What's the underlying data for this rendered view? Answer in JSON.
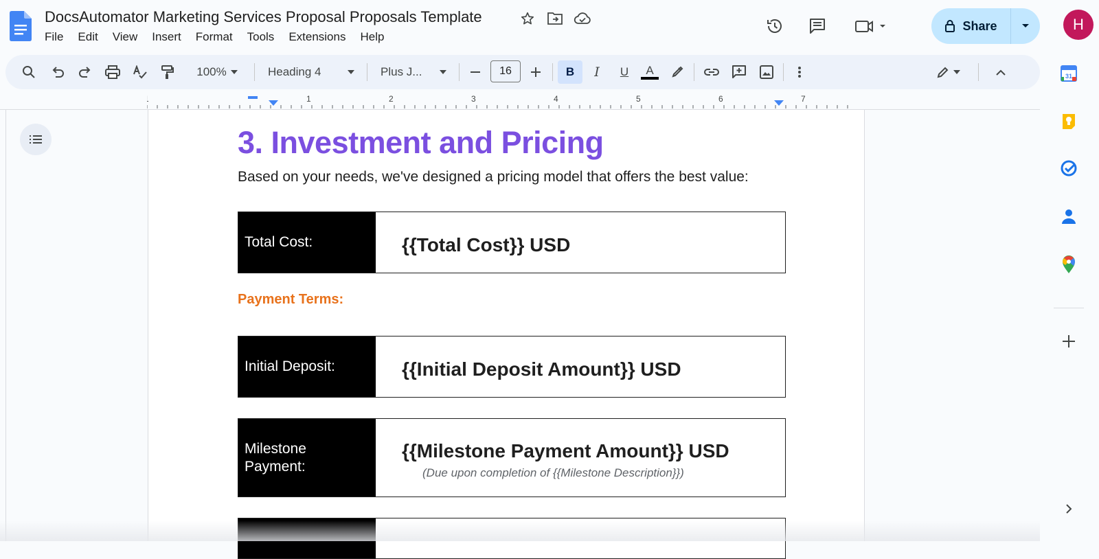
{
  "app": {
    "doc_title": "DocsAutomator Marketing Services Proposal Proposals Template",
    "menu": [
      "File",
      "Edit",
      "View",
      "Insert",
      "Format",
      "Tools",
      "Extensions",
      "Help"
    ],
    "share_label": "Share",
    "avatar_letter": "H",
    "accent_color": "#c2e7ff"
  },
  "toolbar": {
    "zoom": "100%",
    "style": "Heading 4",
    "font": "Plus J...",
    "font_size": "16",
    "bold_label": "B",
    "italic_label": "I",
    "underline_label": "U",
    "text_color_label": "A"
  },
  "ruler": {
    "numbers": [
      "1",
      "1",
      "2",
      "3",
      "4",
      "5",
      "6",
      "7"
    ]
  },
  "document": {
    "heading": "3. Investment and Pricing",
    "intro": "Based on your needs, we've designed a pricing model that offers the best value:",
    "payment_terms_label": "Payment Terms:",
    "total_cost": {
      "label": "Total Cost:",
      "value": "{{Total Cost}} USD"
    },
    "initial_deposit": {
      "label": "Initial Deposit:",
      "value": "{{Initial Deposit Amount}} USD"
    },
    "milestone": {
      "label_line1": "Milestone",
      "label_line2": "Payment:",
      "value": "{{Milestone Payment Amount}} USD",
      "note": "(Due upon completion of {{Milestone Description}})"
    },
    "heading_color": "#7b4fe0",
    "payment_terms_color": "#e8721c"
  },
  "side_panel": {
    "icons": [
      "calendar-icon",
      "keep-icon",
      "tasks-icon",
      "contacts-icon",
      "maps-icon",
      "add-icon",
      "expand-icon"
    ],
    "calendar_day": "31"
  }
}
